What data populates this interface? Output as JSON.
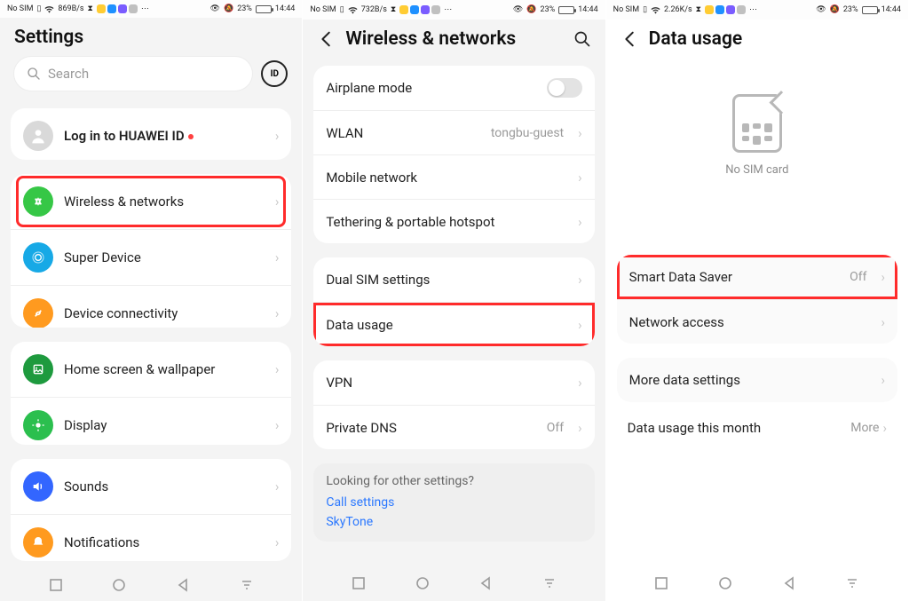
{
  "status": {
    "no_sim": "No SIM",
    "eye_pct": "23%",
    "time": "14:44",
    "rates": [
      "869B/s",
      "732B/s",
      "2.26K/s"
    ]
  },
  "screen1": {
    "title": "Settings",
    "search_placeholder": "Search",
    "login_label": "Log in to HUAWEI ID",
    "items": {
      "wireless": "Wireless & networks",
      "super_device": "Super Device",
      "device_conn": "Device connectivity",
      "home_screen": "Home screen & wallpaper",
      "display": "Display",
      "sounds": "Sounds",
      "notifications": "Notifications"
    }
  },
  "screen2": {
    "title": "Wireless & networks",
    "rows": {
      "airplane": "Airplane mode",
      "wlan": "WLAN",
      "wlan_val": "tongbu-guest",
      "mobile_net": "Mobile network",
      "tether": "Tethering & portable hotspot",
      "dual_sim": "Dual SIM settings",
      "data_usage": "Data usage",
      "vpn": "VPN",
      "private_dns": "Private DNS",
      "private_dns_val": "Off"
    },
    "hint_q": "Looking for other settings?",
    "hint_links": [
      "Call settings",
      "SkyTone"
    ]
  },
  "screen3": {
    "title": "Data usage",
    "no_sim_text": "No SIM card",
    "rows": {
      "smart_saver": "Smart Data Saver",
      "smart_saver_val": "Off",
      "net_access": "Network access",
      "more_settings": "More data settings"
    },
    "footer_label": "Data usage this month",
    "footer_more": "More"
  }
}
